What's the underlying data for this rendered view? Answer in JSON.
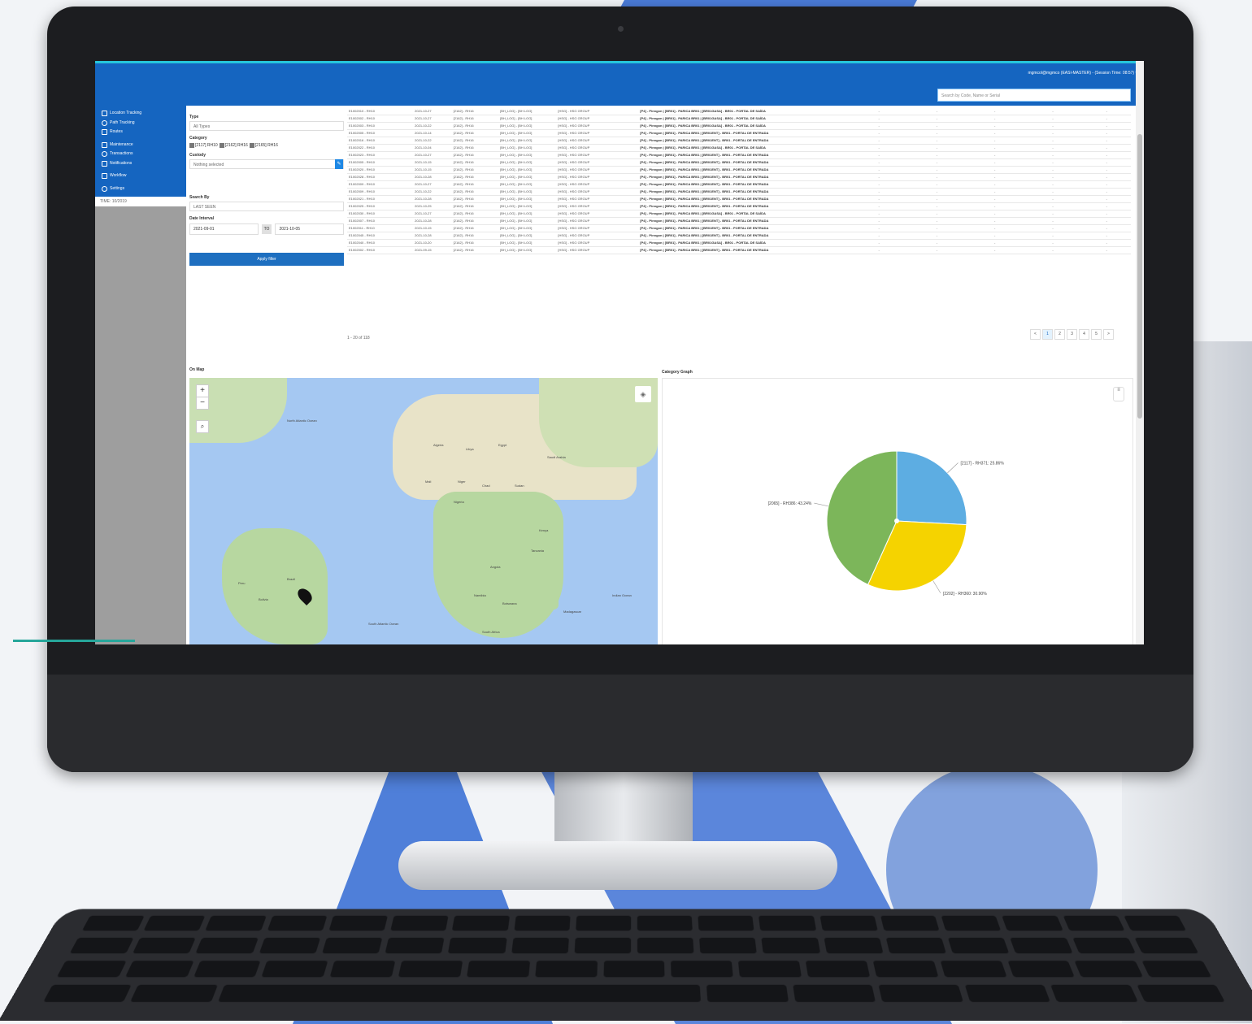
{
  "header": {
    "user_info": "mgmcol@mgmco (EASI-MASTER) - (Session Time: 08:57) ▾",
    "search_placeholder": "Search by Code, Name or Serial"
  },
  "sidebar": {
    "items": [
      {
        "label": "Location Tracking",
        "icon": "square-icon"
      },
      {
        "label": "Path Tracking",
        "icon": "globe-icon"
      },
      {
        "label": "Routes",
        "icon": "route-icon"
      },
      {
        "label": "Maintenance",
        "icon": "wrench-icon"
      },
      {
        "label": "Transactions",
        "icon": "gear-icon"
      },
      {
        "label": "Notifications",
        "icon": "mail-icon"
      },
      {
        "label": "Workflow",
        "icon": "square-icon"
      },
      {
        "label": "Settings",
        "icon": "gear-icon"
      }
    ],
    "footer": "TIME: 10/2019"
  },
  "filters": {
    "type_label": "Type",
    "type_value": "All Types",
    "category_label": "Category",
    "categories": [
      "[2117] RH10",
      "[2162] RH16",
      "[2165] RH16"
    ],
    "custody_label": "Custody",
    "custody_value": "Nothing selected",
    "search_by_label": "Search By",
    "search_by_value": "LAST SEEN",
    "date_interval_label": "Date Interval",
    "date_from": "2021-09-01",
    "date_to_label": "TO",
    "date_to": "2021-10-05",
    "apply_label": "Apply filter"
  },
  "table": {
    "rows": [
      [
        "E1002010 - RH10",
        "2021-10-27",
        "[2162] - RH16",
        "[BH_LOG] - [BH LOG]",
        "[HSG] - HSG GROUP",
        "[P4] - Pinngon | [BR01] - PARICA BR01 | [BR01GASA] - BR01 - PORTAL DE SAÍDA",
        "-",
        "-",
        "-",
        "-",
        "-"
      ],
      [
        "E1002002 - RH10",
        "2021-10-27",
        "[2162] - RH16",
        "[BH_LOG] - [BH LOG]",
        "[HSG] - HSG GROUP",
        "[P4] - Pinngon | [BR01] - PARICA BR01 | [BR01GASA] - BR01 - PORTAL DE SAÍDA",
        "-",
        "-",
        "-",
        "-",
        "-"
      ],
      [
        "E1002003 - RH10",
        "2021-10-22",
        "[2162] - RH16",
        "[BH_LOG] - [BH LOG]",
        "[HSG] - HSG GROUP",
        "[P4] - Pinngon | [BR01] - PARICA BR01 | [BR01GASA] - BR01 - PORTAL DE SAÍDA",
        "-",
        "-",
        "-",
        "-",
        "-"
      ],
      [
        "E1002005 - RH10",
        "2021-10-14",
        "[2162] - RH16",
        "[BH_LOG] - [BH LOG]",
        "[HSG] - HSG GROUP",
        "[P4] - Pinngon | [BR01] - PARICA BR01 | [BR01ENT] - BR01 - PORTAL DE ENTRADA",
        "-",
        "-",
        "-",
        "-",
        "-"
      ],
      [
        "E1002016 - RH10",
        "2021-10-22",
        "[2162] - RH16",
        "[BH_LOG] - [BH LOG]",
        "[HSG] - HSG GROUP",
        "[P4] - Pinngon | [BR01] - PARICA BR01 | [BR01ENT] - BR01 - PORTAL DE ENTRADA",
        "-",
        "-",
        "-",
        "-",
        "-"
      ],
      [
        "E1002022 - RH10",
        "2021-10-04",
        "[2162] - RH16",
        "[BH_LOG] - [BH LOG]",
        "[HSG] - HSG GROUP",
        "[P4] - Pinngon | [BR01] - PARICA BR01 | [BR01GASA] - BR01 - PORTAL DE SAÍDA",
        "-",
        "-",
        "-",
        "-",
        "-"
      ],
      [
        "E1002023 - RH10",
        "2021-10-27",
        "[2162] - RH16",
        "[BH_LOG] - [BH LOG]",
        "[HSG] - HSG GROUP",
        "[P4] - Pinngon | [BR01] - PARICA BR01 | [BR01ENT] - BR01 - PORTAL DE ENTRADA",
        "-",
        "-",
        "-",
        "-",
        "-"
      ],
      [
        "E1002005 - RH10",
        "2021-10-15",
        "[2162] - RH16",
        "[BH_LOG] - [BH LOG]",
        "[HSG] - HSG GROUP",
        "[P4] - Pinngon | [BR01] - PARICA BR01 | [BR01ENT] - BR01 - PORTAL DE ENTRADA",
        "-",
        "-",
        "-",
        "-",
        "-"
      ],
      [
        "E1002020 - RH10",
        "2021-10-15",
        "[2162] - RH16",
        "[BH_LOG] - [BH LOG]",
        "[HSG] - HSG GROUP",
        "[P4] - Pinngon | [BR01] - PARICA BR01 | [BR01ENT] - BR01 - PORTAL DE ENTRADA",
        "-",
        "-",
        "-",
        "-",
        "-"
      ],
      [
        "E1002028 - RH10",
        "2021-10-28",
        "[2162] - RH16",
        "[BH_LOG] - [BH LOG]",
        "[HSG] - HSG GROUP",
        "[P4] - Pinngon | [BR01] - PARICA BR01 | [BR01ENT] - BR01 - PORTAL DE ENTRADA",
        "-",
        "-",
        "-",
        "-",
        "-"
      ],
      [
        "E1002009 - RH10",
        "2021-10-27",
        "[2162] - RH16",
        "[BH_LOG] - [BH LOG]",
        "[HSG] - HSG GROUP",
        "[P4] - Pinngon | [BR01] - PARICA BR01 | [BR01ENT] - BR01 - PORTAL DE ENTRADA",
        "-",
        "-",
        "-",
        "-",
        "-"
      ],
      [
        "E1002009 - RH10",
        "2021-10-22",
        "[2162] - RH16",
        "[BH_LOG] - [BH LOG]",
        "[HSG] - HSG GROUP",
        "[P4] - Pinngon | [BR01] - PARICA BR01 | [BR01ENT] - BR01 - PORTAL DE ENTRADA",
        "-",
        "-",
        "-",
        "-",
        "-"
      ],
      [
        "E1002021 - RH10",
        "2021-10-28",
        "[2162] - RH16",
        "[BH_LOG] - [BH LOG]",
        "[HSG] - HSG GROUP",
        "[P4] - Pinngon | [BR01] - PARICA BR01 | [BR01ENT] - BR01 - PORTAL DE ENTRADA",
        "-",
        "-",
        "-",
        "-",
        "-"
      ],
      [
        "E1002025 - RH10",
        "2021-10-25",
        "[2162] - RH16",
        "[BH_LOG] - [BH LOG]",
        "[HSG] - HSG GROUP",
        "[P4] - Pinngon | [BR01] - PARICA BR01 | [BR01ENT] - BR01 - PORTAL DE ENTRADA",
        "-",
        "-",
        "-",
        "-",
        "-"
      ],
      [
        "E1002030 - RH10",
        "2021-10-27",
        "[2162] - RH16",
        "[BH_LOG] - [BH LOG]",
        "[HSG] - HSG GROUP",
        "[P4] - Pinngon | [BR01] - PARICA BR01 | [BR01GASA] - BR01 - PORTAL DE SAÍDA",
        "-",
        "-",
        "-",
        "-",
        "-"
      ],
      [
        "E1002007 - RH10",
        "2021-10-28",
        "[2162] - RH16",
        "[BH_LOG] - [BH LOG]",
        "[HSG] - HSG GROUP",
        "[P4] - Pinngon | [BR01] - PARICA BR01 | [BR01ENT] - BR01 - PORTAL DE ENTRADA",
        "-",
        "-",
        "-",
        "-",
        "-"
      ],
      [
        "E1002011 - RH10",
        "2021-10-15",
        "[2162] - RH16",
        "[BH_LOG] - [BH LOG]",
        "[HSG] - HSG GROUP",
        "[P4] - Pinngon | [BR01] - PARICA BR01 | [BR01ENT] - BR01 - PORTAL DE ENTRADA",
        "-",
        "-",
        "-",
        "-",
        "-"
      ],
      [
        "E1002045 - RH10",
        "2021-10-28",
        "[2162] - RH16",
        "[BH_LOG] - [BH LOG]",
        "[HSG] - HSG GROUP",
        "[P4] - Pinngon | [BR01] - PARICA BR01 | [BR01ENT] - BR01 - PORTAL DE ENTRADA",
        "-",
        "-",
        "-",
        "-",
        "-"
      ],
      [
        "E1002040 - RH10",
        "2021-10-20",
        "[2162] - RH16",
        "[BH_LOG] - [BH LOG]",
        "[HSG] - HSG GROUP",
        "[P4] - Pinngon | [BR01] - PARICA BR01 | [BR01GASA] - BR01 - PORTAL DE SAÍDA",
        "-",
        "-",
        "-",
        "-",
        "-"
      ],
      [
        "E1002002 - RH10",
        "2021-09-15",
        "[2162] - RH16",
        "[BH_LOG] - [BH LOG]",
        "[HSG] - HSG GROUP",
        "[P4] - Pinngon | [BR01] - PARICA BR01 | [BR01ENT] - BR01 - PORTAL DE ENTRADA",
        "-",
        "-",
        "-",
        "-",
        "-"
      ]
    ],
    "count_text": "1 - 20 of 118",
    "pages": [
      "<",
      "1",
      "2",
      "3",
      "4",
      "5",
      ">"
    ],
    "active_page": "1"
  },
  "map": {
    "title": "On Map",
    "zoom_in": "+",
    "zoom_out": "−",
    "labels": [
      "North Atlantic Ocean",
      "Algeria",
      "Libya",
      "Egypt",
      "Mali",
      "Niger",
      "Chad",
      "Sudan",
      "Nigeria",
      "Saudi Arabia",
      "Kenya",
      "Tanzania",
      "Angola",
      "Namibia",
      "Botswana",
      "South Africa",
      "Brazil",
      "Peru",
      "Bolivia",
      "South Atlantic Ocean",
      "Madagascar",
      "Indian Ocean"
    ]
  },
  "chart_data": {
    "type": "pie",
    "title": "Category Graph",
    "labels": [
      "[2117] - RH371",
      "[2202] - RH360",
      "[2065] - RH386"
    ],
    "values": [
      25.86,
      30.9,
      43.24
    ],
    "display_labels": [
      "[2117] - RH371: 25.86%",
      "[2202] - RH360: 30.90%",
      "[2065] - RH386: 43.24%"
    ],
    "colors": [
      "#5dade2",
      "#f5d300",
      "#7cb65a"
    ]
  }
}
